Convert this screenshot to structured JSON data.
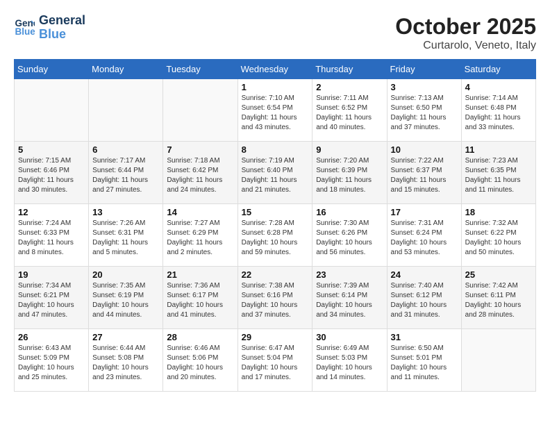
{
  "logo": {
    "line1": "General",
    "line2": "Blue"
  },
  "title": "October 2025",
  "subtitle": "Curtarolo, Veneto, Italy",
  "weekdays": [
    "Sunday",
    "Monday",
    "Tuesday",
    "Wednesday",
    "Thursday",
    "Friday",
    "Saturday"
  ],
  "weeks": [
    [
      {
        "day": "",
        "info": ""
      },
      {
        "day": "",
        "info": ""
      },
      {
        "day": "",
        "info": ""
      },
      {
        "day": "1",
        "info": "Sunrise: 7:10 AM\nSunset: 6:54 PM\nDaylight: 11 hours\nand 43 minutes."
      },
      {
        "day": "2",
        "info": "Sunrise: 7:11 AM\nSunset: 6:52 PM\nDaylight: 11 hours\nand 40 minutes."
      },
      {
        "day": "3",
        "info": "Sunrise: 7:13 AM\nSunset: 6:50 PM\nDaylight: 11 hours\nand 37 minutes."
      },
      {
        "day": "4",
        "info": "Sunrise: 7:14 AM\nSunset: 6:48 PM\nDaylight: 11 hours\nand 33 minutes."
      }
    ],
    [
      {
        "day": "5",
        "info": "Sunrise: 7:15 AM\nSunset: 6:46 PM\nDaylight: 11 hours\nand 30 minutes."
      },
      {
        "day": "6",
        "info": "Sunrise: 7:17 AM\nSunset: 6:44 PM\nDaylight: 11 hours\nand 27 minutes."
      },
      {
        "day": "7",
        "info": "Sunrise: 7:18 AM\nSunset: 6:42 PM\nDaylight: 11 hours\nand 24 minutes."
      },
      {
        "day": "8",
        "info": "Sunrise: 7:19 AM\nSunset: 6:40 PM\nDaylight: 11 hours\nand 21 minutes."
      },
      {
        "day": "9",
        "info": "Sunrise: 7:20 AM\nSunset: 6:39 PM\nDaylight: 11 hours\nand 18 minutes."
      },
      {
        "day": "10",
        "info": "Sunrise: 7:22 AM\nSunset: 6:37 PM\nDaylight: 11 hours\nand 15 minutes."
      },
      {
        "day": "11",
        "info": "Sunrise: 7:23 AM\nSunset: 6:35 PM\nDaylight: 11 hours\nand 11 minutes."
      }
    ],
    [
      {
        "day": "12",
        "info": "Sunrise: 7:24 AM\nSunset: 6:33 PM\nDaylight: 11 hours\nand 8 minutes."
      },
      {
        "day": "13",
        "info": "Sunrise: 7:26 AM\nSunset: 6:31 PM\nDaylight: 11 hours\nand 5 minutes."
      },
      {
        "day": "14",
        "info": "Sunrise: 7:27 AM\nSunset: 6:29 PM\nDaylight: 11 hours\nand 2 minutes."
      },
      {
        "day": "15",
        "info": "Sunrise: 7:28 AM\nSunset: 6:28 PM\nDaylight: 10 hours\nand 59 minutes."
      },
      {
        "day": "16",
        "info": "Sunrise: 7:30 AM\nSunset: 6:26 PM\nDaylight: 10 hours\nand 56 minutes."
      },
      {
        "day": "17",
        "info": "Sunrise: 7:31 AM\nSunset: 6:24 PM\nDaylight: 10 hours\nand 53 minutes."
      },
      {
        "day": "18",
        "info": "Sunrise: 7:32 AM\nSunset: 6:22 PM\nDaylight: 10 hours\nand 50 minutes."
      }
    ],
    [
      {
        "day": "19",
        "info": "Sunrise: 7:34 AM\nSunset: 6:21 PM\nDaylight: 10 hours\nand 47 minutes."
      },
      {
        "day": "20",
        "info": "Sunrise: 7:35 AM\nSunset: 6:19 PM\nDaylight: 10 hours\nand 44 minutes."
      },
      {
        "day": "21",
        "info": "Sunrise: 7:36 AM\nSunset: 6:17 PM\nDaylight: 10 hours\nand 41 minutes."
      },
      {
        "day": "22",
        "info": "Sunrise: 7:38 AM\nSunset: 6:16 PM\nDaylight: 10 hours\nand 37 minutes."
      },
      {
        "day": "23",
        "info": "Sunrise: 7:39 AM\nSunset: 6:14 PM\nDaylight: 10 hours\nand 34 minutes."
      },
      {
        "day": "24",
        "info": "Sunrise: 7:40 AM\nSunset: 6:12 PM\nDaylight: 10 hours\nand 31 minutes."
      },
      {
        "day": "25",
        "info": "Sunrise: 7:42 AM\nSunset: 6:11 PM\nDaylight: 10 hours\nand 28 minutes."
      }
    ],
    [
      {
        "day": "26",
        "info": "Sunrise: 6:43 AM\nSunset: 5:09 PM\nDaylight: 10 hours\nand 25 minutes."
      },
      {
        "day": "27",
        "info": "Sunrise: 6:44 AM\nSunset: 5:08 PM\nDaylight: 10 hours\nand 23 minutes."
      },
      {
        "day": "28",
        "info": "Sunrise: 6:46 AM\nSunset: 5:06 PM\nDaylight: 10 hours\nand 20 minutes."
      },
      {
        "day": "29",
        "info": "Sunrise: 6:47 AM\nSunset: 5:04 PM\nDaylight: 10 hours\nand 17 minutes."
      },
      {
        "day": "30",
        "info": "Sunrise: 6:49 AM\nSunset: 5:03 PM\nDaylight: 10 hours\nand 14 minutes."
      },
      {
        "day": "31",
        "info": "Sunrise: 6:50 AM\nSunset: 5:01 PM\nDaylight: 10 hours\nand 11 minutes."
      },
      {
        "day": "",
        "info": ""
      }
    ]
  ]
}
